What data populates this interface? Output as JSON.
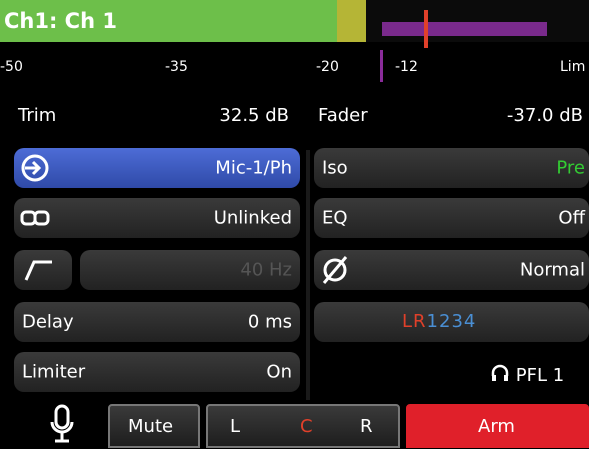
{
  "channel": {
    "title": "Ch1: Ch 1"
  },
  "meter": {
    "ticks": [
      "-50",
      "-35",
      "-20",
      "-12",
      "Lim"
    ]
  },
  "trim": {
    "label": "Trim",
    "value": "32.5 dB"
  },
  "fader": {
    "label": "Fader",
    "value": "-37.0 dB"
  },
  "input": {
    "value": "Mic-1/Ph",
    "icon": "input-source-icon"
  },
  "link": {
    "value": "Unlinked",
    "icon": "link-icon"
  },
  "hpf": {
    "value": "40 Hz",
    "icon": "high-pass-filter-icon"
  },
  "delay": {
    "label": "Delay",
    "value": "0 ms"
  },
  "limiter": {
    "label": "Limiter",
    "value": "On"
  },
  "iso": {
    "label": "Iso",
    "value": "Pre"
  },
  "eq": {
    "label": "EQ",
    "value": "Off"
  },
  "phase": {
    "value": "Normal",
    "icon": "phase-invert-icon"
  },
  "routing": {
    "l": "L",
    "r": "R",
    "buses": "1234"
  },
  "pfl": {
    "value": "PFL 1",
    "icon": "headphones-icon"
  },
  "bottom": {
    "mic_icon": "microphone-icon",
    "mute": "Mute",
    "pan_l": "L",
    "pan_c": "C",
    "pan_r": "R",
    "arm": "Arm"
  },
  "colors": {
    "accent_blue": "#3c5cc4",
    "green_meter": "#6dbf4a",
    "iso_pre_green": "#33cc33",
    "arm_red": "#e0202a",
    "route_red": "#e0402a",
    "route_blue": "#4a8fd4"
  }
}
